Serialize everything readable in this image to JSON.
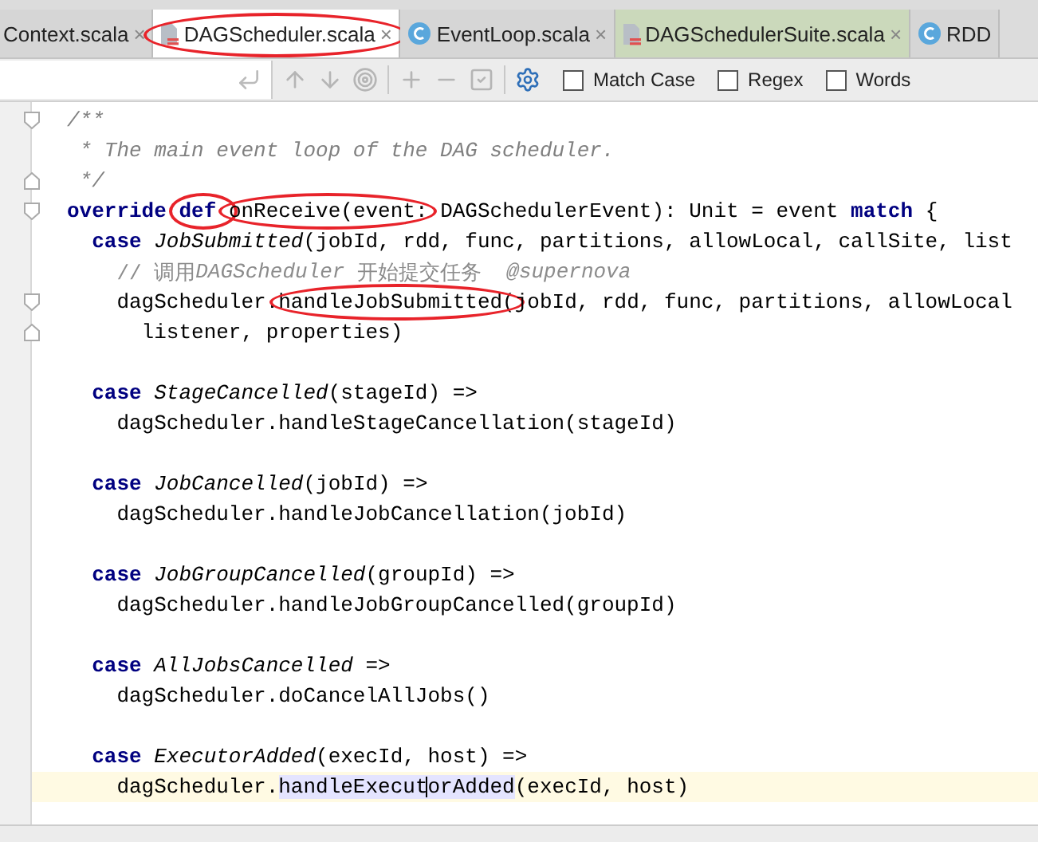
{
  "tabs": [
    {
      "label": "Context.scala",
      "kind": "none",
      "selected": false,
      "modified": false,
      "close": "×",
      "circled": false
    },
    {
      "label": "DAGScheduler.scala",
      "kind": "file",
      "selected": true,
      "modified": false,
      "close": "×",
      "circled": true
    },
    {
      "label": "EventLoop.scala",
      "kind": "class",
      "selected": false,
      "modified": false,
      "close": "×",
      "circled": false
    },
    {
      "label": "DAGSchedulerSuite.scala",
      "kind": "file",
      "selected": false,
      "modified": true,
      "close": "×",
      "circled": false
    },
    {
      "label": "RDD",
      "kind": "class",
      "selected": false,
      "modified": false,
      "circled": false
    }
  ],
  "search": {
    "options": [
      {
        "label": "Match Case",
        "checked": false
      },
      {
        "label": "Regex",
        "checked": false
      },
      {
        "label": "Words",
        "checked": false
      }
    ]
  },
  "lines": [
    {
      "fold_open": true,
      "tokens": [
        {
          "text": "/**",
          "kind": "doc"
        }
      ]
    },
    {
      "tokens": [
        {
          "text": " * The main event loop of the DAG scheduler.",
          "kind": "doc"
        }
      ]
    },
    {
      "fold_close": true,
      "tokens": [
        {
          "text": " */",
          "kind": "doc"
        }
      ]
    },
    {
      "fold_open": true,
      "tokens": [
        {
          "text": "override ",
          "kind": "keyword"
        },
        {
          "text": "def ",
          "kind": "keyword",
          "circled": true
        },
        {
          "text": "onReceive(event:",
          "kind": "plain",
          "circled": true
        },
        {
          "text": " DAGSchedulerEvent): Unit = event ",
          "kind": "plain"
        },
        {
          "text": "match",
          "kind": "keyword"
        },
        {
          "text": " {",
          "kind": "plain"
        }
      ]
    },
    {
      "tokens": [
        {
          "text": "  case ",
          "kind": "keyword"
        },
        {
          "text": "JobSubmitted",
          "kind": "type"
        },
        {
          "text": "(jobId, rdd, func, partitions, allowLocal, callSite, list",
          "kind": "plain"
        }
      ]
    },
    {
      "tokens": [
        {
          "text": "    // 调用",
          "kind": "comment"
        },
        {
          "text": "DAGScheduler",
          "kind": "comment-italic"
        },
        {
          "text": " 开始提交任务  ",
          "kind": "comment"
        },
        {
          "text": "@supernova",
          "kind": "comment-italic"
        }
      ]
    },
    {
      "fold_open": true,
      "tokens": [
        {
          "text": "    dagScheduler.",
          "kind": "plain"
        },
        {
          "text": "handleJobSubmitted(",
          "kind": "plain",
          "circled": true
        },
        {
          "text": "jobId, rdd, func, partitions, allowLocal",
          "kind": "plain"
        }
      ]
    },
    {
      "fold_close": true,
      "tokens": [
        {
          "text": "      listener, properties)",
          "kind": "plain"
        }
      ]
    },
    {
      "kind": "blank"
    },
    {
      "tokens": [
        {
          "text": "  case ",
          "kind": "keyword"
        },
        {
          "text": "StageCancelled",
          "kind": "type"
        },
        {
          "text": "(stageId) =>",
          "kind": "plain"
        }
      ]
    },
    {
      "tokens": [
        {
          "text": "    dagScheduler.handleStageCancellation(stageId)",
          "kind": "plain"
        }
      ]
    },
    {
      "kind": "blank"
    },
    {
      "tokens": [
        {
          "text": "  case ",
          "kind": "keyword"
        },
        {
          "text": "JobCancelled",
          "kind": "type"
        },
        {
          "text": "(jobId) =>",
          "kind": "plain"
        }
      ]
    },
    {
      "tokens": [
        {
          "text": "    dagScheduler.handleJobCancellation(jobId)",
          "kind": "plain"
        }
      ]
    },
    {
      "kind": "blank"
    },
    {
      "tokens": [
        {
          "text": "  case ",
          "kind": "keyword"
        },
        {
          "text": "JobGroupCancelled",
          "kind": "type"
        },
        {
          "text": "(groupId) =>",
          "kind": "plain"
        }
      ]
    },
    {
      "tokens": [
        {
          "text": "    dagScheduler.handleJobGroupCancelled(groupId)",
          "kind": "plain"
        }
      ]
    },
    {
      "kind": "blank"
    },
    {
      "tokens": [
        {
          "text": "  case ",
          "kind": "keyword"
        },
        {
          "text": "AllJobsCancelled",
          "kind": "type"
        },
        {
          "text": " =>",
          "kind": "plain"
        }
      ]
    },
    {
      "tokens": [
        {
          "text": "    dagScheduler.doCancelAllJobs()",
          "kind": "plain"
        }
      ]
    },
    {
      "kind": "blank"
    },
    {
      "tokens": [
        {
          "text": "  case ",
          "kind": "keyword"
        },
        {
          "text": "ExecutorAdded",
          "kind": "type"
        },
        {
          "text": "(execId, host) =>",
          "kind": "plain"
        }
      ]
    },
    {
      "current": true,
      "tokens": [
        {
          "text": "    dagScheduler.",
          "kind": "plain"
        },
        {
          "text": "handleExecut",
          "kind": "highlight",
          "caret": true
        },
        {
          "text": "orAdded",
          "kind": "highlight"
        },
        {
          "text": "(execId, host)",
          "kind": "plain"
        }
      ]
    }
  ]
}
